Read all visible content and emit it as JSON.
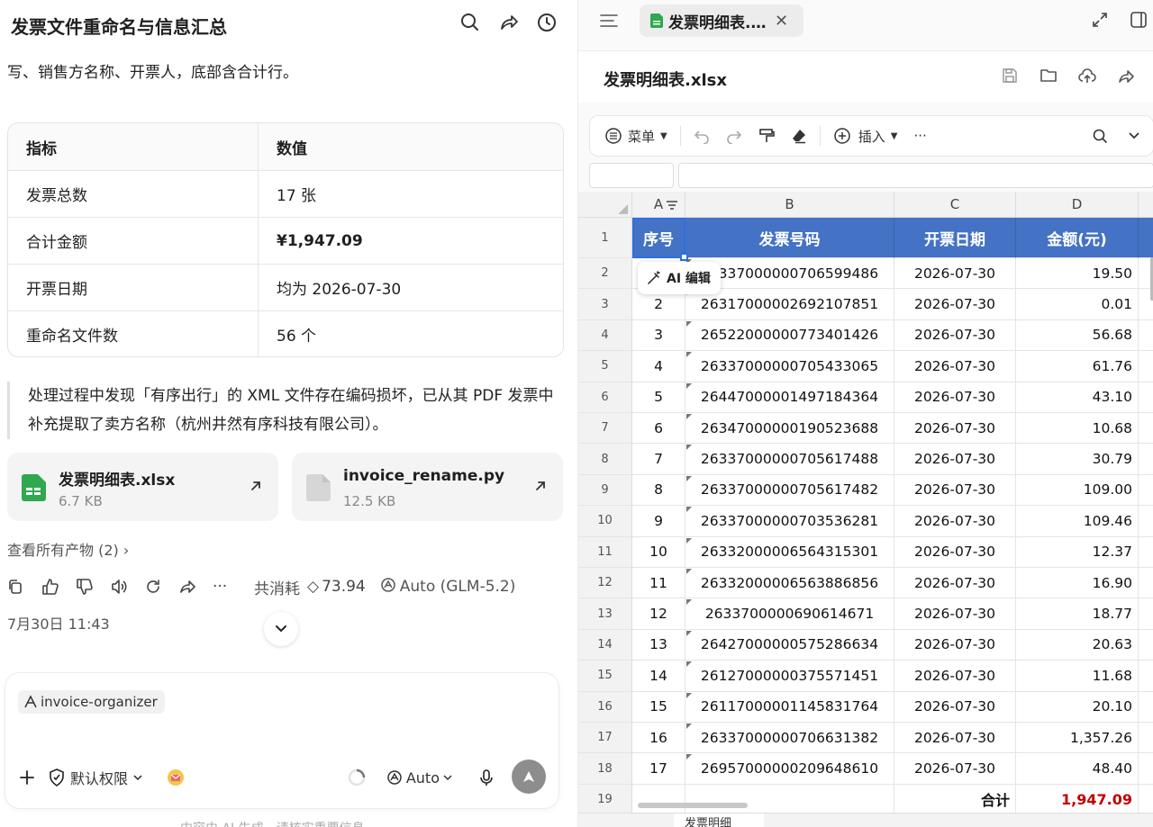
{
  "chat": {
    "title": "发票文件重命名与信息汇总",
    "intro_text": "写、销售方名称、开票人，底部含合计行。",
    "summary_table": {
      "headers": [
        "指标",
        "数值"
      ],
      "rows": [
        [
          "发票总数",
          "17 张"
        ],
        [
          "合计金额",
          "¥1,947.09"
        ],
        [
          "开票日期",
          "均为 2026-07-30"
        ],
        [
          "重命名文件数",
          "56 个"
        ]
      ]
    },
    "note": "处理过程中发现「有序出行」的 XML 文件存在编码损坏，已从其 PDF 发票中补充提取了卖方名称（杭州井然有序科技有限公司）。",
    "files": [
      {
        "name": "发票明细表.xlsx",
        "size": "6.7 KB",
        "icon": "spreadsheet-file-icon",
        "color": "#2fa84f"
      },
      {
        "name": "invoice_rename.py",
        "size": "12.5 KB",
        "icon": "document-file-icon",
        "color": "#d0d0d0"
      }
    ],
    "all_outputs": "查看所有产物 (2)",
    "cost_label": "共消耗",
    "cost_value": "73.94",
    "model_label": "Auto (GLM-5.2)",
    "timestamp": "7月30日 11:43",
    "composer": {
      "chip": "invoice-organizer",
      "permission": "默认权限",
      "mode": "Auto"
    },
    "footnote": "内容由 AI 生成，请核实重要信息"
  },
  "sheet": {
    "tab_title": "发票明细表.…",
    "file_name": "发票明细表.xlsx",
    "toolbar": {
      "menu": "菜单",
      "insert": "插入",
      "more": "···"
    },
    "columns": [
      "A",
      "B",
      "C",
      "D"
    ],
    "headers": [
      "序号",
      "发票号码",
      "开票日期",
      "金额(元)"
    ],
    "row_numbers": [
      "1",
      "2",
      "3",
      "4",
      "5",
      "6",
      "7",
      "8",
      "9",
      "10",
      "11",
      "12",
      "13",
      "14",
      "15",
      "16",
      "17",
      "18",
      "19"
    ],
    "rows": [
      [
        "1",
        "26337000000706599486",
        "2026-07-30",
        "19.50"
      ],
      [
        "2",
        "26317000002692107851",
        "2026-07-30",
        "0.01"
      ],
      [
        "3",
        "26522000000773401426",
        "2026-07-30",
        "56.68"
      ],
      [
        "4",
        "26337000000705433065",
        "2026-07-30",
        "61.76"
      ],
      [
        "5",
        "26447000001497184364",
        "2026-07-30",
        "43.10"
      ],
      [
        "6",
        "26347000000190523688",
        "2026-07-30",
        "10.68"
      ],
      [
        "7",
        "26337000000705617488",
        "2026-07-30",
        "30.79"
      ],
      [
        "8",
        "26337000000705617482",
        "2026-07-30",
        "109.00"
      ],
      [
        "9",
        "26337000000703536281",
        "2026-07-30",
        "109.46"
      ],
      [
        "10",
        "26332000006564315301",
        "2026-07-30",
        "12.37"
      ],
      [
        "11",
        "26332000006563886856",
        "2026-07-30",
        "16.90"
      ],
      [
        "12",
        "2633700000690614671",
        "2026-07-30",
        "18.77"
      ],
      [
        "13",
        "26427000000575286634",
        "2026-07-30",
        "20.63"
      ],
      [
        "14",
        "26127000000375571451",
        "2026-07-30",
        "11.68"
      ],
      [
        "15",
        "26117000001145831764",
        "2026-07-30",
        "20.10"
      ],
      [
        "16",
        "26337000000706631382",
        "2026-07-30",
        "1,357.26"
      ],
      [
        "17",
        "26957000000209648610",
        "2026-07-30",
        "48.40"
      ]
    ],
    "total_label": "合计",
    "total_value": "1,947.09",
    "ai_edit": "AI 编辑",
    "sheet_tab": "发票明细"
  }
}
